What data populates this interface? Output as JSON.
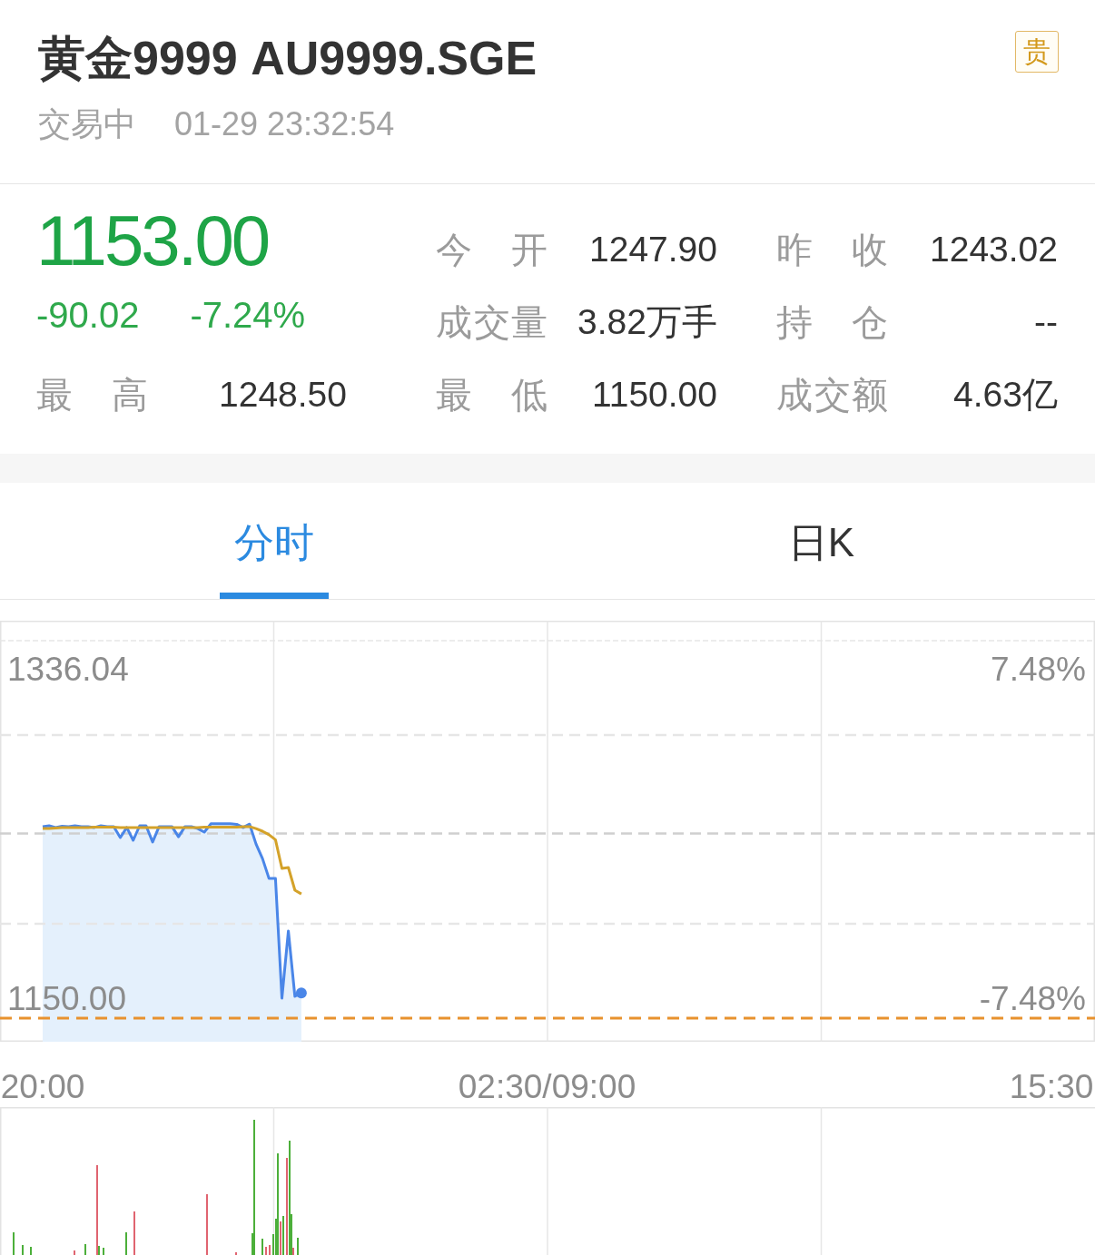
{
  "header": {
    "title": "黄金9999 AU9999.SGE",
    "badge": "贵",
    "status": "交易中",
    "timestamp": "01-29 23:32:54"
  },
  "quote": {
    "price": "1153.00",
    "change": "-90.02",
    "change_percent": "-7.24%"
  },
  "stats": [
    {
      "label": "今开",
      "value": "1247.90"
    },
    {
      "label": "昨收",
      "value": "1243.02"
    },
    {
      "label": "成交量",
      "value": "3.82万手"
    },
    {
      "label": "持仓",
      "value": "--"
    },
    {
      "label": "最高",
      "value": "1248.50"
    },
    {
      "label": "最低",
      "value": "1150.00"
    },
    {
      "label": "成交额",
      "value": "4.63亿"
    }
  ],
  "tabs": [
    {
      "label": "分时",
      "selected": true
    },
    {
      "label": "日K",
      "selected": false
    }
  ],
  "chart": {
    "percent_labels": [
      "7.48%",
      "-7.48%"
    ],
    "chart_data": {
      "type": "line",
      "categories": [
        "20:00",
        null,
        null,
        null,
        null,
        null,
        null,
        null,
        null,
        null,
        null,
        null,
        null,
        null,
        null,
        null,
        null,
        null,
        null,
        null,
        null,
        null,
        null,
        null,
        null,
        null,
        null,
        null,
        null,
        null,
        null,
        null,
        null,
        null,
        null,
        null,
        null,
        null,
        null,
        null,
        null,
        null,
        null,
        null,
        null,
        null,
        null,
        null,
        null,
        null,
        null,
        null,
        null,
        null,
        null,
        null,
        null,
        null,
        null,
        null,
        null,
        null,
        null,
        null,
        null,
        null,
        null,
        null,
        null,
        null,
        null,
        null,
        null,
        null,
        null,
        null,
        null,
        null,
        "02:30/09:00",
        null,
        null,
        null,
        null,
        null,
        null,
        null,
        null,
        null,
        null,
        null,
        null,
        null,
        null,
        null,
        null,
        null,
        null,
        null,
        null,
        null,
        null,
        null,
        null,
        null,
        null,
        null,
        null,
        null,
        null,
        null,
        null,
        null,
        null,
        null,
        null,
        null,
        null,
        null,
        null,
        null,
        null,
        null,
        null,
        null,
        null,
        null,
        null,
        null,
        null,
        null,
        null,
        null,
        null,
        null,
        null,
        null,
        null,
        null,
        null,
        null,
        null,
        null,
        null,
        null,
        null,
        null,
        null,
        null,
        null,
        null,
        null,
        null,
        null,
        null,
        null,
        null,
        "15:30"
      ],
      "series": [
        {
          "color": "#4a86e8",
          "values": [
            1246.9,
            1247.4,
            1246.4,
            1247.1,
            1246.9,
            1247.4,
            1246.9,
            1246.9,
            1246.4,
            1247.4,
            1246.9,
            1246.9,
            1240.7,
            1246.4,
            1239.2,
            1247.4,
            1247.4,
            1238.2,
            1246.9,
            1246.9,
            1246.9,
            1241.2,
            1246.9,
            1246.9,
            1245.8,
            1243.8,
            1248.5,
            1248.5,
            1248.5,
            1248.5,
            1248.2,
            1246.4,
            1248.3,
            1237.1,
            1228.9,
            1217.6,
            1217.6,
            1150,
            1187.9,
            1151,
            1153,
            null,
            null,
            null,
            null,
            null,
            null,
            null,
            null,
            null,
            null,
            null,
            null,
            null,
            null,
            null,
            null,
            null,
            null,
            null,
            null,
            null,
            null,
            null,
            null,
            null,
            null,
            null,
            null,
            null,
            null,
            null,
            null,
            null,
            null,
            null,
            null,
            null,
            null,
            null,
            null,
            null,
            null,
            null,
            null,
            null,
            null,
            null,
            null,
            null,
            null,
            null,
            null,
            null,
            null,
            null,
            null,
            null,
            null,
            null,
            null,
            null,
            null,
            null,
            null,
            null,
            null,
            null,
            null,
            null,
            null,
            null,
            null,
            null,
            null,
            null,
            null,
            null,
            null,
            null,
            null,
            null,
            null,
            null,
            null,
            null,
            null,
            null,
            null,
            null,
            null,
            null,
            null,
            null,
            null,
            null,
            null,
            null,
            null,
            null,
            null,
            null,
            null,
            null,
            null,
            null,
            null,
            null,
            null,
            null,
            null,
            null,
            null,
            null,
            null,
            null,
            null
          ]
        },
        {
          "color": "#d4a22a",
          "values": [
            1245.8,
            1245.8,
            1246.1,
            1246.4,
            1246.4,
            1246.4,
            1246.4,
            1246.4,
            1246.6,
            1246.6,
            1246.6,
            1246.6,
            1246.4,
            1246.4,
            1246.4,
            1246.4,
            1246.4,
            1246.4,
            1246.4,
            1246.4,
            1246.4,
            1246.4,
            1246.4,
            1246.4,
            1246.4,
            1246.6,
            1246.6,
            1246.6,
            1246.6,
            1246.6,
            1246.6,
            1246.9,
            1246.9,
            1245.8,
            1244.3,
            1242.3,
            1239.5,
            1223.3,
            1223.8,
            1211,
            1208.9,
            null,
            null,
            null,
            null,
            null,
            null,
            null,
            null,
            null,
            null,
            null,
            null,
            null,
            null,
            null,
            null,
            null,
            null,
            null,
            null,
            null,
            null,
            null,
            null,
            null,
            null,
            null,
            null,
            null,
            null,
            null,
            null,
            null,
            null,
            null,
            null,
            null,
            null,
            null,
            null,
            null,
            null,
            null,
            null,
            null,
            null,
            null,
            null,
            null,
            null,
            null,
            null,
            null,
            null,
            null,
            null,
            null,
            null,
            null,
            null,
            null,
            null,
            null,
            null,
            null,
            null,
            null,
            null,
            null,
            null,
            null,
            null,
            null,
            null,
            null,
            null,
            null,
            null,
            null,
            null,
            null,
            null,
            null,
            null,
            null,
            null,
            null,
            null,
            null,
            null,
            null,
            null,
            null,
            null,
            null,
            null,
            null,
            null,
            null,
            null,
            null,
            null,
            null,
            null,
            null,
            null,
            null,
            null,
            null,
            null,
            null,
            null,
            null,
            null,
            null,
            null
          ]
        }
      ],
      "ylim": [
        1150,
        1336.04
      ],
      "yticks": [
        {
          "value": 1336.04,
          "label": "1336.04"
        },
        {
          "value": 1150,
          "label": "1150.00"
        }
      ],
      "ref_lines": [
        {
          "axis": "y",
          "value": 1298.6,
          "color": "#e6e6e6"
        },
        {
          "axis": "y",
          "value": 1243.02,
          "color": "#cfcfcf"
        },
        {
          "axis": "y",
          "value": 1192,
          "color": "#e6e6e6"
        }
      ]
    }
  }
}
